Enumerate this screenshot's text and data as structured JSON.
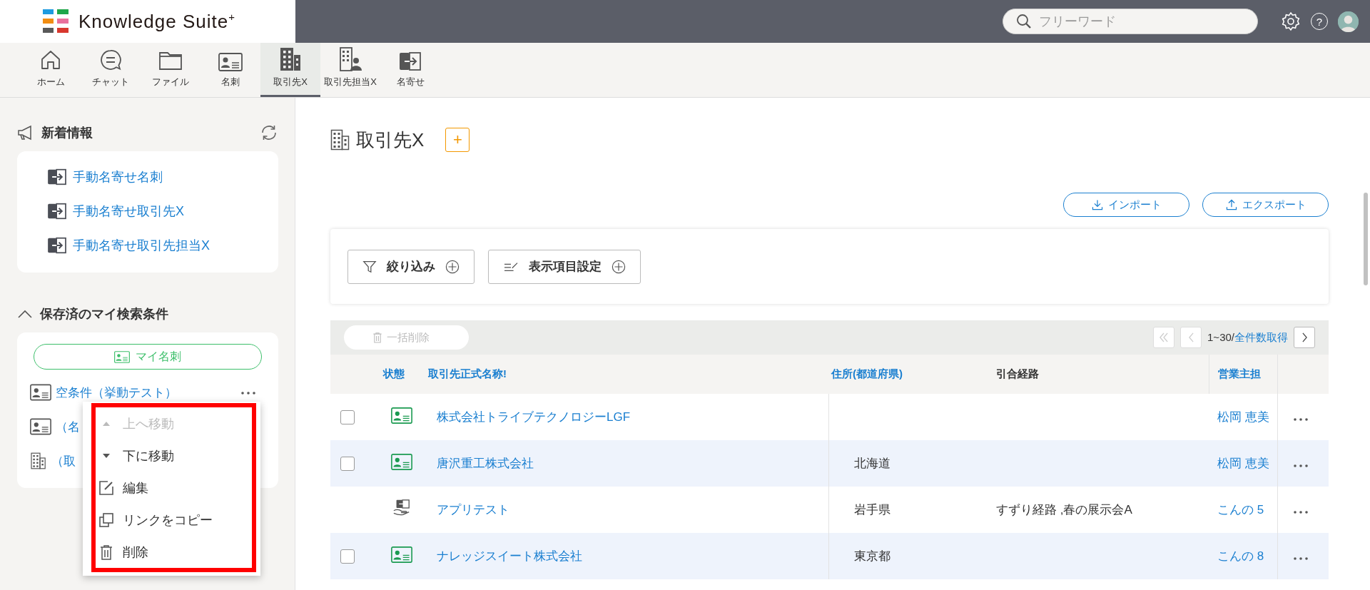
{
  "header": {
    "logo": "Knowledge Suite$^{+}$",
    "search": {
      "placeholder": "フリーワード"
    },
    "help": "?"
  },
  "nav": [
    {
      "label": "ホーム",
      "kind": "home",
      "selected": false
    },
    {
      "label": "チャット",
      "kind": "chat",
      "selected": false
    },
    {
      "label": "ファイル",
      "kind": "folder",
      "selected": false
    },
    {
      "label": "名刺",
      "kind": "card",
      "selected": false
    },
    {
      "label": "取引先X",
      "kind": "building",
      "selected": true
    },
    {
      "label": "取引先担当X",
      "kind": "building-person",
      "selected": false
    },
    {
      "label": "名寄せ",
      "kind": "merge",
      "selected": false
    }
  ],
  "news": {
    "title": "新着情報",
    "items": [
      {
        "label": "手動名寄せ名刺"
      },
      {
        "label": "手動名寄せ取引先X"
      },
      {
        "label": "手動名寄せ取引先担当X"
      }
    ]
  },
  "saved": {
    "title": "保存済のマイ検索条件",
    "expanded": true,
    "my_card": "マイ名刺",
    "items": [
      {
        "kind": "card",
        "label": "空条件（挙動テスト）"
      },
      {
        "kind": "card",
        "label": "（名"
      },
      {
        "kind": "building",
        "label": "（取"
      }
    ]
  },
  "context_menu": {
    "highlighted": true,
    "items": [
      {
        "kind": "move-up",
        "label": "上へ移動",
        "disabled": true
      },
      {
        "kind": "move-down",
        "label": "下に移動",
        "disabled": false
      },
      {
        "kind": "edit",
        "label": "編集",
        "disabled": false
      },
      {
        "kind": "copy-link",
        "label": "リンクをコピー",
        "disabled": false
      },
      {
        "kind": "delete",
        "label": "削除",
        "disabled": false
      }
    ]
  },
  "page": {
    "title": "取引先X",
    "add": "+",
    "import": "インポート",
    "export": "エクスポート",
    "filters": [
      {
        "kind": "filter",
        "label": "絞り込み"
      },
      {
        "kind": "columns",
        "label": "表示項目設定"
      }
    ]
  },
  "toolbar": {
    "bulk_delete": {
      "label": "一括削除",
      "disabled": true
    },
    "pager": {
      "buttons": [
        {
          "kind": "first",
          "disabled": true
        },
        {
          "kind": "prev",
          "disabled": true
        },
        {
          "kind": "next",
          "disabled": false
        }
      ],
      "range": "1~30/",
      "total_link": "全件数取得"
    }
  },
  "table": {
    "columns": [
      {
        "label": "状態",
        "sortable": true
      },
      {
        "label": "取引先正式名称!",
        "sortable": true
      },
      {
        "label": "住所(都道府県)",
        "sortable": true
      },
      {
        "label": "引合経路",
        "sortable": false
      },
      {
        "label": "営業主担",
        "sortable": true
      }
    ],
    "rows": [
      {
        "checked": false,
        "kind": "card",
        "name": "株式会社トライブテクノロジーLGF",
        "owner": "松岡 恵美"
      },
      {
        "checked": false,
        "kind": "card",
        "name": "唐沢重工株式会社",
        "prefecture": "北海道",
        "owner": "松岡 恵美"
      },
      {
        "kind": "merge",
        "name": "アプリテスト",
        "prefecture": "岩手県",
        "route": "すずり経路 ,春の展示会A",
        "owner": "こんの 5"
      },
      {
        "checked": false,
        "kind": "card",
        "name": "ナレッジスイート株式会社",
        "prefecture": "東京都",
        "owner": "こんの 8"
      }
    ]
  }
}
